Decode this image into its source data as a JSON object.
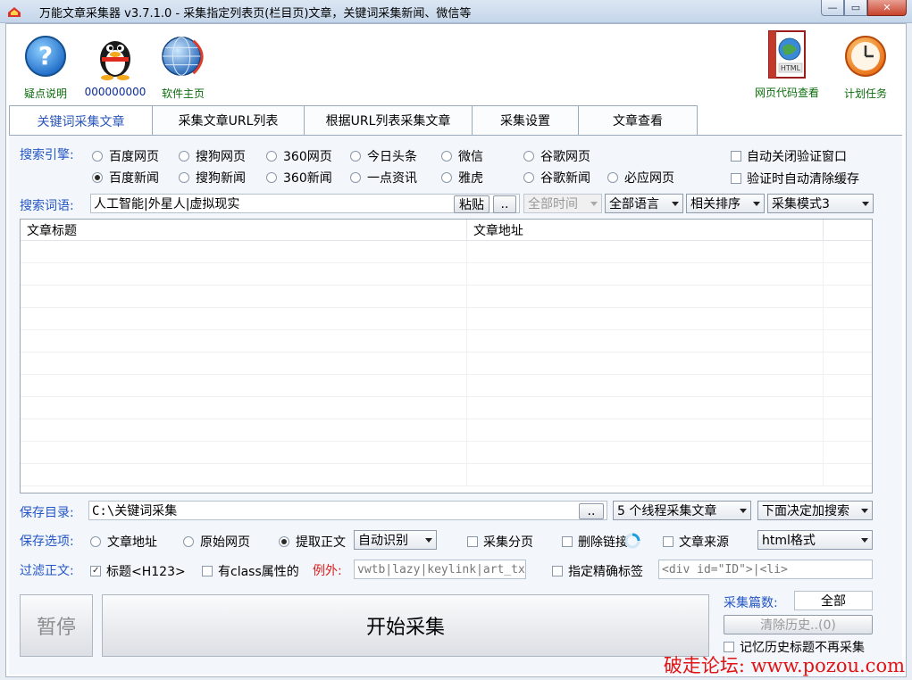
{
  "window": {
    "title": "万能文章采集器 v3.7.1.0 - 采集指定列表页(栏目页)文章，关键词采集新闻、微信等",
    "min": "—",
    "max": "▭",
    "close": "✕"
  },
  "toolbar": {
    "help": "疑点说明",
    "qq": "000000000",
    "home": "软件主页",
    "html_view": "网页代码查看",
    "schedule": "计划任务",
    "html_icon_text": "HTML"
  },
  "tabs": [
    "关键词采集文章",
    "采集文章URL列表",
    "根据URL列表采集文章",
    "采集设置",
    "文章查看"
  ],
  "engine": {
    "label": "搜索引擎:",
    "row1": [
      "百度网页",
      "搜狗网页",
      "360网页",
      "今日头条",
      "微信",
      "谷歌网页"
    ],
    "row2": [
      "百度新闻",
      "搜狗新闻",
      "360新闻",
      "一点资讯",
      "雅虎",
      "谷歌新闻",
      "必应网页"
    ],
    "selected": "百度新闻",
    "opt_close_verify": "自动关闭验证窗口",
    "opt_clear_cache": "验证时自动清除缓存"
  },
  "search": {
    "label": "搜索词语:",
    "value": "人工智能|外星人|虚拟现实",
    "paste": "粘贴",
    "more": "..",
    "time": "全部时间",
    "lang": "全部语言",
    "sort": "相关排序",
    "mode": "采集模式3"
  },
  "grid": {
    "col_title": "文章标题",
    "col_url": "文章地址"
  },
  "save_dir": {
    "label": "保存目录:",
    "value": "C:\\关键词采集",
    "more": "..",
    "threads": "5 个线程采集文章",
    "decide": "下面决定加搜索"
  },
  "save_opts": {
    "label": "保存选项:",
    "radios": [
      "文章地址",
      "原始网页",
      "提取正文"
    ],
    "selected": "提取正文",
    "auto": "自动识别",
    "paging": "采集分页",
    "remove_links": "删除链接",
    "source": "文章来源",
    "format": "html格式"
  },
  "filter": {
    "label": "过滤正文:",
    "title_tag": "标题<H123>",
    "class_attr": "有class属性的",
    "except_label": "例外:",
    "except_value": "vwtb|lazy|keylink|art_tx",
    "precise": "指定精确标签",
    "precise_value": "<div id=\"ID\">|<li>"
  },
  "actions": {
    "pause": "暂停",
    "start": "开始采集",
    "count_label": "采集篇数:",
    "count_value": "全部",
    "clear_history": "清除历史..(0)",
    "remember": "记忆历史标题不再采集"
  },
  "watermark": "破走论坛: www.pozou.com",
  "colors": {
    "accent_blue": "#2456c4",
    "watermark_red": "#e01414",
    "tool_green": "#0a6b0a"
  }
}
